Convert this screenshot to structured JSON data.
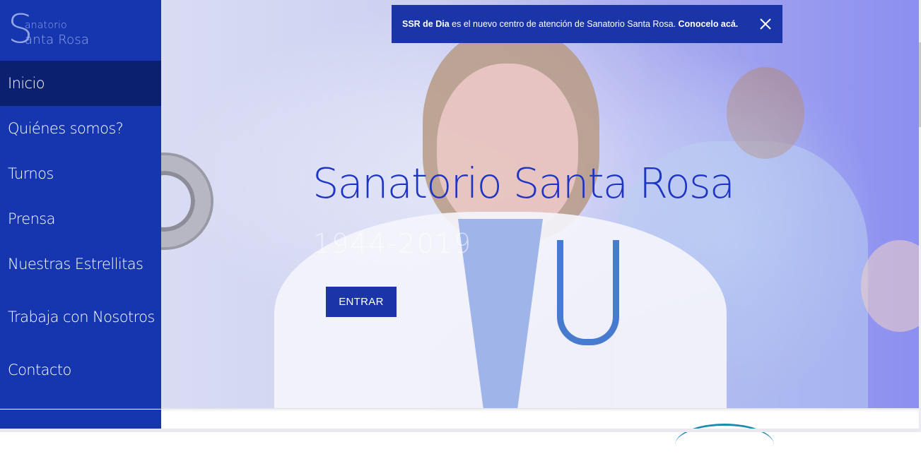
{
  "brand": {
    "logo_initial": "S",
    "logo_line1": "anatorio",
    "logo_line2": "anta Rosa",
    "colors": {
      "sidebar": "#1636b0",
      "sidebar_active": "#0b2170",
      "accent": "#1a35a8",
      "title": "#1e34c2"
    }
  },
  "sidebar": {
    "items": [
      {
        "label": "Inicio",
        "active": true
      },
      {
        "label": "Quiénes somos?"
      },
      {
        "label": "Turnos"
      },
      {
        "label": "Prensa"
      },
      {
        "label": "Nuestras Estrellitas"
      },
      {
        "label": "Trabaja con Nosotros"
      },
      {
        "label": "Contacto"
      }
    ]
  },
  "notice": {
    "bold_prefix": "SSR de Dia",
    "text": " es el nuevo centro de atención de Sanatorio Santa Rosa. ",
    "link": "Conocelo acá.",
    "close_icon": "close-icon"
  },
  "hero": {
    "title": "Sanatorio Santa Rosa",
    "years": "1944-2019",
    "button_label": "ENTRAR"
  }
}
